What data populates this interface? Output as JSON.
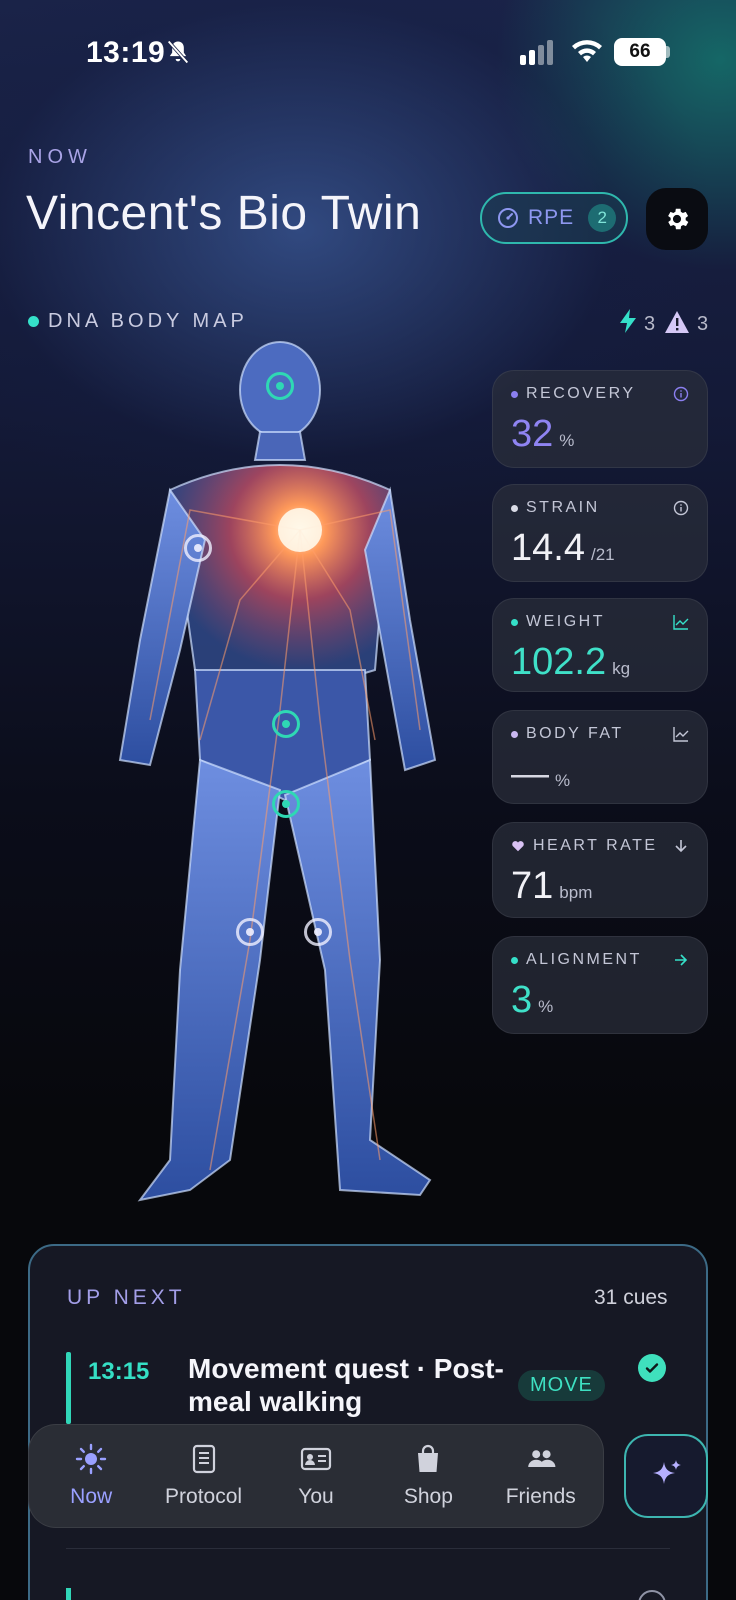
{
  "status_bar": {
    "time": "13:19",
    "battery": "66"
  },
  "header": {
    "eyebrow": "NOW",
    "title": "Vincent's Bio Twin",
    "rpe_label": "RPE",
    "rpe_count": "2"
  },
  "body_map": {
    "label": "DNA BODY MAP",
    "energy_count": "3",
    "alert_count": "3"
  },
  "metrics": [
    {
      "label": "RECOVERY",
      "value": "32",
      "unit": "%",
      "dot_color": "#8b7ff0",
      "value_color": "#8f84f2",
      "icon": "info-icon"
    },
    {
      "label": "STRAIN",
      "value": "14.4",
      "unit": "/21",
      "dot_color": "#d9dbe6",
      "value_color": "#f1f1f6",
      "icon": "info-icon"
    },
    {
      "label": "WEIGHT",
      "value": "102.2",
      "unit": "kg",
      "dot_color": "#35e0c9",
      "value_color": "#3fe0c8",
      "icon": "chart-icon"
    },
    {
      "label": "BODY FAT",
      "value": "—",
      "unit": "%",
      "dot_color": "#c9b7f0",
      "value_color": "#d7d8e2",
      "icon": "chart-icon"
    },
    {
      "label": "HEART RATE",
      "value": "71",
      "unit": "bpm",
      "dot_color": "#d9c2f3",
      "value_color": "#f1f1f6",
      "icon": "arrow-down-icon"
    },
    {
      "label": "ALIGNMENT",
      "value": "3",
      "unit": "%",
      "dot_color": "#35e0c9",
      "value_color": "#3fe0c8",
      "icon": "arrow-right-icon"
    }
  ],
  "up_next": {
    "label": "UP NEXT",
    "count": "31 cues",
    "tasks": [
      {
        "time": "13:15",
        "title": "Movement quest · Post-meal walking",
        "tag": "MOVE"
      }
    ]
  },
  "tabs": [
    {
      "label": "Now",
      "icon": "sun-icon",
      "active": true
    },
    {
      "label": "Protocol",
      "icon": "document-icon"
    },
    {
      "label": "You",
      "icon": "id-card-icon"
    },
    {
      "label": "Shop",
      "icon": "bag-icon"
    },
    {
      "label": "Friends",
      "icon": "people-icon"
    }
  ],
  "colors": {
    "accent_teal": "#35e0c9",
    "accent_purple": "#8f84f2"
  }
}
